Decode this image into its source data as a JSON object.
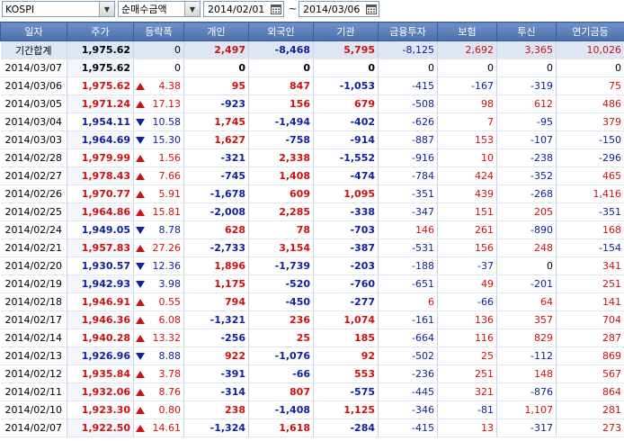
{
  "toolbar": {
    "market": "KOSPI",
    "mode": "순매수금액",
    "date_from": "2014/02/01",
    "separator": "~",
    "date_to": "2014/03/06"
  },
  "columns": [
    "일자",
    "주가",
    "등락폭",
    "개인",
    "외국인",
    "기관",
    "금융투자",
    "보험",
    "투신",
    "연기금등"
  ],
  "colors": {
    "up": "#d01010",
    "down": "#1020a0",
    "header": "#5a7cb8"
  },
  "rows": [
    {
      "date": "기간합계",
      "price": "1,975.62",
      "dir": "none",
      "chg": "0",
      "indiv": "2,497",
      "foreign": "-8,468",
      "inst": "5,795",
      "fin": "-8,125",
      "ins": "2,692",
      "trust": "3,365",
      "pension": "10,026"
    },
    {
      "date": "2014/03/07",
      "price": "1,975.62",
      "dir": "none",
      "chg": "0",
      "indiv": "0",
      "foreign": "0",
      "inst": "0",
      "fin": "0",
      "ins": "0",
      "trust": "0",
      "pension": "0"
    },
    {
      "date": "2014/03/06",
      "price": "1,975.62",
      "dir": "up",
      "chg": "4.38",
      "indiv": "95",
      "foreign": "847",
      "inst": "-1,053",
      "fin": "-415",
      "ins": "-167",
      "trust": "-319",
      "pension": "75"
    },
    {
      "date": "2014/03/05",
      "price": "1,971.24",
      "dir": "up",
      "chg": "17.13",
      "indiv": "-923",
      "foreign": "156",
      "inst": "679",
      "fin": "-508",
      "ins": "98",
      "trust": "612",
      "pension": "486"
    },
    {
      "date": "2014/03/04",
      "price": "1,954.11",
      "dir": "down",
      "chg": "10.58",
      "indiv": "1,745",
      "foreign": "-1,494",
      "inst": "-402",
      "fin": "-626",
      "ins": "7",
      "trust": "-95",
      "pension": "379"
    },
    {
      "date": "2014/03/03",
      "price": "1,964.69",
      "dir": "down",
      "chg": "15.30",
      "indiv": "1,627",
      "foreign": "-758",
      "inst": "-914",
      "fin": "-887",
      "ins": "153",
      "trust": "-107",
      "pension": "-150"
    },
    {
      "date": "2014/02/28",
      "price": "1,979.99",
      "dir": "up",
      "chg": "1.56",
      "indiv": "-321",
      "foreign": "2,338",
      "inst": "-1,552",
      "fin": "-916",
      "ins": "10",
      "trust": "-238",
      "pension": "-296"
    },
    {
      "date": "2014/02/27",
      "price": "1,978.43",
      "dir": "up",
      "chg": "7.66",
      "indiv": "-745",
      "foreign": "1,408",
      "inst": "-474",
      "fin": "-784",
      "ins": "424",
      "trust": "-352",
      "pension": "465"
    },
    {
      "date": "2014/02/26",
      "price": "1,970.77",
      "dir": "up",
      "chg": "5.91",
      "indiv": "-1,678",
      "foreign": "609",
      "inst": "1,095",
      "fin": "-351",
      "ins": "439",
      "trust": "-268",
      "pension": "1,416"
    },
    {
      "date": "2014/02/25",
      "price": "1,964.86",
      "dir": "up",
      "chg": "15.81",
      "indiv": "-2,008",
      "foreign": "2,285",
      "inst": "-338",
      "fin": "-347",
      "ins": "151",
      "trust": "205",
      "pension": "-351"
    },
    {
      "date": "2014/02/24",
      "price": "1,949.05",
      "dir": "down",
      "chg": "8.78",
      "indiv": "628",
      "foreign": "78",
      "inst": "-703",
      "fin": "146",
      "ins": "261",
      "trust": "-890",
      "pension": "168"
    },
    {
      "date": "2014/02/21",
      "price": "1,957.83",
      "dir": "up",
      "chg": "27.26",
      "indiv": "-2,733",
      "foreign": "3,154",
      "inst": "-387",
      "fin": "-531",
      "ins": "156",
      "trust": "248",
      "pension": "-154"
    },
    {
      "date": "2014/02/20",
      "price": "1,930.57",
      "dir": "down",
      "chg": "12.36",
      "indiv": "1,896",
      "foreign": "-1,739",
      "inst": "-203",
      "fin": "-188",
      "ins": "-37",
      "trust": "0",
      "pension": "341"
    },
    {
      "date": "2014/02/19",
      "price": "1,942.93",
      "dir": "down",
      "chg": "3.98",
      "indiv": "1,175",
      "foreign": "-520",
      "inst": "-760",
      "fin": "-651",
      "ins": "49",
      "trust": "-201",
      "pension": "251"
    },
    {
      "date": "2014/02/18",
      "price": "1,946.91",
      "dir": "up",
      "chg": "0.55",
      "indiv": "794",
      "foreign": "-450",
      "inst": "-277",
      "fin": "6",
      "ins": "-66",
      "trust": "64",
      "pension": "141"
    },
    {
      "date": "2014/02/17",
      "price": "1,946.36",
      "dir": "up",
      "chg": "6.08",
      "indiv": "-1,321",
      "foreign": "236",
      "inst": "1,074",
      "fin": "-161",
      "ins": "136",
      "trust": "357",
      "pension": "704"
    },
    {
      "date": "2014/02/14",
      "price": "1,940.28",
      "dir": "up",
      "chg": "13.32",
      "indiv": "-256",
      "foreign": "25",
      "inst": "185",
      "fin": "-664",
      "ins": "116",
      "trust": "829",
      "pension": "287"
    },
    {
      "date": "2014/02/13",
      "price": "1,926.96",
      "dir": "down",
      "chg": "8.88",
      "indiv": "922",
      "foreign": "-1,076",
      "inst": "92",
      "fin": "-502",
      "ins": "25",
      "trust": "-112",
      "pension": "869"
    },
    {
      "date": "2014/02/12",
      "price": "1,935.84",
      "dir": "up",
      "chg": "3.78",
      "indiv": "-391",
      "foreign": "-66",
      "inst": "553",
      "fin": "-236",
      "ins": "251",
      "trust": "148",
      "pension": "567"
    },
    {
      "date": "2014/02/11",
      "price": "1,932.06",
      "dir": "up",
      "chg": "8.76",
      "indiv": "-314",
      "foreign": "807",
      "inst": "-575",
      "fin": "-445",
      "ins": "321",
      "trust": "-876",
      "pension": "864"
    },
    {
      "date": "2014/02/10",
      "price": "1,923.30",
      "dir": "up",
      "chg": "0.80",
      "indiv": "238",
      "foreign": "-1,408",
      "inst": "1,125",
      "fin": "-346",
      "ins": "-81",
      "trust": "1,107",
      "pension": "281"
    },
    {
      "date": "2014/02/07",
      "price": "1,922.50",
      "dir": "up",
      "chg": "14.61",
      "indiv": "-1,324",
      "foreign": "1,618",
      "inst": "-284",
      "fin": "-415",
      "ins": "13",
      "trust": "-317",
      "pension": "273"
    }
  ]
}
